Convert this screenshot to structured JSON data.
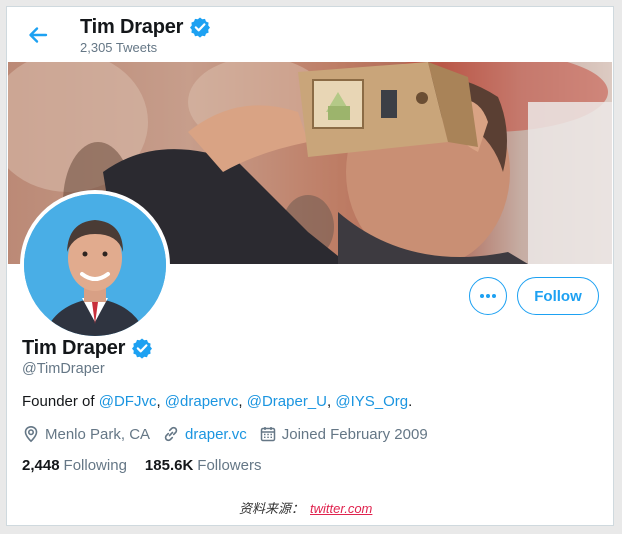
{
  "header": {
    "name": "Tim Draper",
    "tweet_count": "2,305 Tweets",
    "back_icon": "arrow-left-icon",
    "verified_icon": "verified-badge-icon"
  },
  "profile": {
    "display_name": "Tim Draper",
    "handle": "@TimDraper",
    "bio": {
      "prefix": "Founder of ",
      "mentions": [
        "@DFJvc",
        "@drapervc",
        "@Draper_U",
        "@IYS_Org"
      ],
      "separator": ", ",
      "suffix": "."
    },
    "location": "Menlo Park, CA",
    "website": "draper.vc",
    "joined": "Joined February 2009",
    "following_count": "2,448",
    "following_label": "Following",
    "followers_count": "185.6K",
    "followers_label": "Followers"
  },
  "actions": {
    "follow_label": "Follow",
    "more_label": "•••"
  },
  "footer": {
    "source_label": "资料来源：",
    "source_link": "twitter.com"
  },
  "colors": {
    "accent": "#1da1f2",
    "link": "#1b95e0",
    "muted": "#657786",
    "source_link": "#e0234e"
  }
}
